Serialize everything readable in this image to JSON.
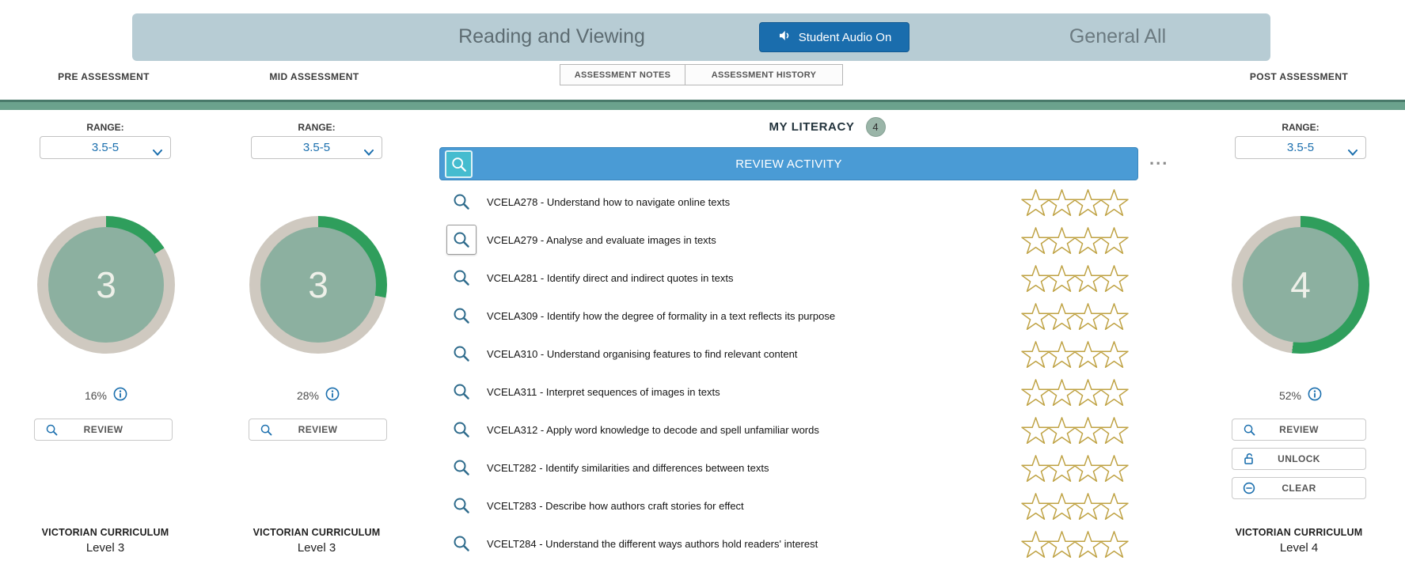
{
  "header": {
    "title": "Reading and Viewing",
    "audio_button_label": "Student Audio On",
    "context_label": "General All"
  },
  "toolbar": {
    "pre_label": "PRE ASSESSMENT",
    "mid_label": "MID ASSESSMENT",
    "notes_label": "ASSESSMENT NOTES",
    "history_label": "ASSESSMENT HISTORY",
    "post_label": "POST ASSESSMENT"
  },
  "panels": {
    "pre": {
      "range_label": "RANGE:",
      "range_value": "3.5-5",
      "score": "3",
      "progress": 16,
      "percent_label": "16%",
      "review_label": "REVIEW",
      "curriculum_label": "VICTORIAN CURRICULUM",
      "level_label": "Level 3"
    },
    "mid": {
      "range_label": "RANGE:",
      "range_value": "3.5-5",
      "score": "3",
      "progress": 28,
      "percent_label": "28%",
      "review_label": "REVIEW",
      "curriculum_label": "VICTORIAN CURRICULUM",
      "level_label": "Level 3"
    },
    "post": {
      "range_label": "RANGE:",
      "range_value": "3.5-5",
      "score": "4",
      "progress": 52,
      "percent_label": "52%",
      "review_label": "REVIEW",
      "unlock_label": "UNLOCK",
      "clear_label": "CLEAR",
      "curriculum_label": "VICTORIAN CURRICULUM",
      "level_label": "Level 4"
    }
  },
  "literacy": {
    "title": "MY LITERACY",
    "badge_count": "4",
    "review_activity_label": "REVIEW ACTIVITY",
    "more_label": "...",
    "stars_per_item": 4,
    "items": [
      {
        "label": "VCELA278 - Understand how to navigate online texts",
        "selected": false
      },
      {
        "label": "VCELA279 - Analyse and evaluate images in texts",
        "selected": true
      },
      {
        "label": "VCELA281 - Identify direct and indirect quotes in texts",
        "selected": false
      },
      {
        "label": "VCELA309 - Identify how the degree of formality in a text reflects its purpose",
        "selected": false
      },
      {
        "label": "VCELA310 - Understand organising features to find relevant content",
        "selected": false
      },
      {
        "label": "VCELA311 - Interpret sequences of images in texts",
        "selected": false
      },
      {
        "label": "VCELA312 - Apply word knowledge to decode and spell unfamiliar words",
        "selected": false
      },
      {
        "label": "VCELT282 - Identify similarities and differences between texts",
        "selected": false
      },
      {
        "label": "VCELT283 - Describe how authors craft stories for effect",
        "selected": false
      },
      {
        "label": "VCELT284 - Understand the different ways authors hold readers' interest",
        "selected": false
      }
    ]
  },
  "colors": {
    "accent_blue": "#1b6fae",
    "banner_blue": "#4a9bd5",
    "gauge_green": "#2f9e5c",
    "gauge_track": "#cfc9c0",
    "gauge_fill": "#8cb0a0",
    "star_gold": "#bfa243",
    "teal_bar": "#6ba28d"
  }
}
